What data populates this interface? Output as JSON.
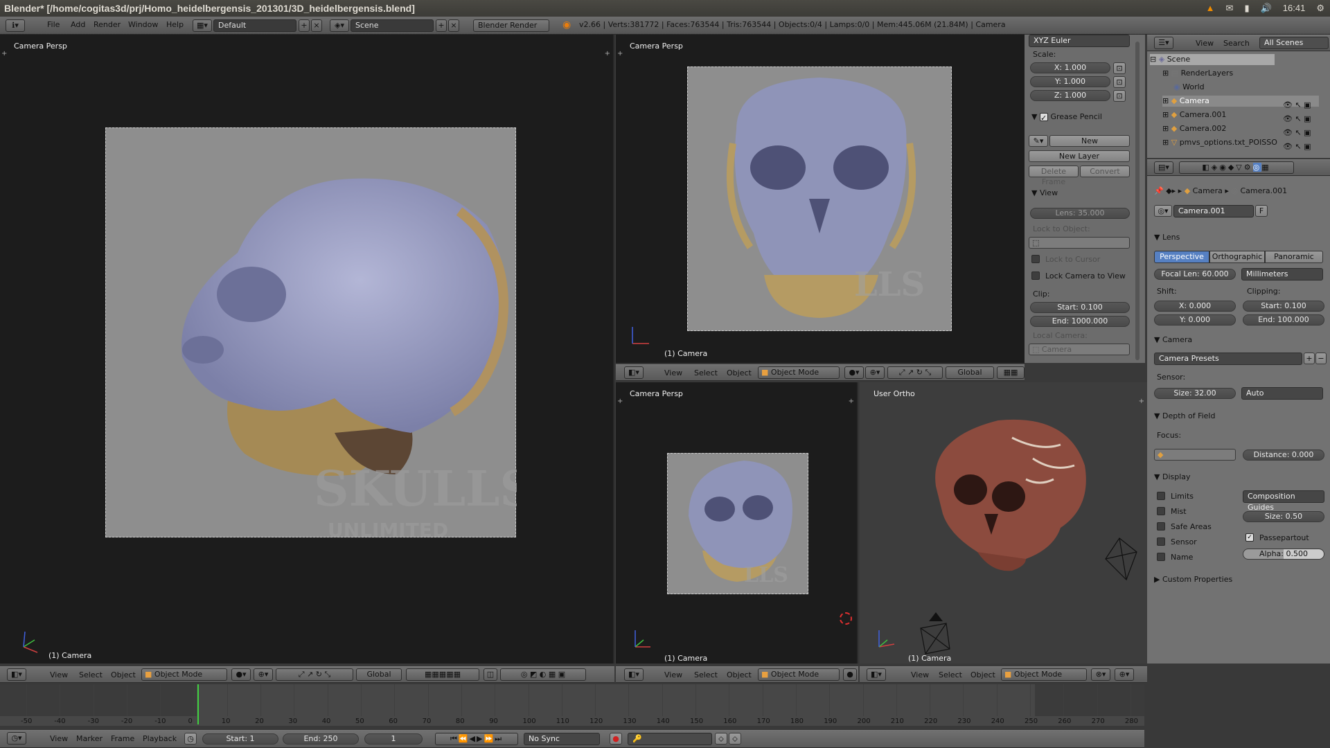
{
  "ubuntu": {
    "title": "Blender* [/home/cogitas3d/prj/Homo_heidelbergensis_201301/3D_heidelbergensis.blend]",
    "clock": "16:41"
  },
  "info": {
    "menus": [
      "File",
      "Add",
      "Render",
      "Window",
      "Help"
    ],
    "layout": "Default",
    "scene": "Scene",
    "engine": "Blender Render",
    "stats": "v2.66 | Verts:381772 | Faces:763544 | Tris:763544 | Objects:0/4 | Lamps:0/0 | Mem:445.06M (21.84M) | Camera"
  },
  "viewports": {
    "large": {
      "label": "Camera Persp",
      "camera": "(1) Camera"
    },
    "top_right": {
      "label": "Camera Persp",
      "camera": "(1) Camera"
    },
    "bottom_mid": {
      "label": "Camera Persp",
      "camera": "(1) Camera"
    },
    "bottom_right": {
      "label": "User Ortho",
      "camera": "(1) Camera"
    }
  },
  "view_header": {
    "menus": [
      "View",
      "Select",
      "Object"
    ],
    "mode": "Object Mode",
    "orientation": "Global"
  },
  "npanel": {
    "rotation_mode": "XYZ Euler",
    "scale_label": "Scale:",
    "scale": [
      "X: 1.000",
      "Y: 1.000",
      "Z: 1.000"
    ],
    "grease_pencil": "Grease Pencil",
    "new": "New",
    "new_layer": "New Layer",
    "delete_frame": "Delete Frame",
    "convert": "Convert",
    "view": "View",
    "lens": "Lens: 35.000",
    "lock_to_object": "Lock to Object:",
    "lock_to_cursor": "Lock to Cursor",
    "lock_camera_to_view": "Lock Camera to View",
    "clip": "Clip:",
    "clip_start": "Start: 0.100",
    "clip_end": "End: 1000.000",
    "local_camera": "Local Camera:",
    "camera": "Camera"
  },
  "outliner": {
    "menus": [
      "View",
      "Search"
    ],
    "filter": "All Scenes",
    "items": [
      "Scene",
      "RenderLayers",
      "World",
      "Camera",
      "Camera.001",
      "Camera.002",
      "pmvs_options.txt_POISSO"
    ]
  },
  "properties": {
    "breadcrumb": [
      "Camera",
      "Camera.001"
    ],
    "datablock": "Camera.001",
    "fake": "F",
    "lens_header": "Lens",
    "lens_tabs": [
      "Perspective",
      "Orthographic",
      "Panoramic"
    ],
    "focal_len": "Focal Len: 60.000",
    "units": "Millimeters",
    "shift": "Shift:",
    "clipping": "Clipping:",
    "shift_x": "X: 0.000",
    "shift_y": "Y: 0.000",
    "clip_start": "Start: 0.100",
    "clip_end": "End: 100.000",
    "camera_header": "Camera",
    "camera_presets": "Camera Presets",
    "sensor": "Sensor:",
    "sensor_size": "Size: 32.00",
    "sensor_fit": "Auto",
    "dof_header": "Depth of Field",
    "focus": "Focus:",
    "distance": "Distance: 0.000",
    "display_header": "Display",
    "display_items": [
      "Limits",
      "Mist",
      "Safe Areas",
      "Sensor",
      "Name"
    ],
    "composition_guides": "Composition Guides",
    "size": "Size: 0.50",
    "passepartout": "Passepartout",
    "alpha": "Alpha: 0.500",
    "custom_props": "Custom Properties"
  },
  "timeline": {
    "ticks": [
      "-50",
      "-40",
      "-30",
      "-20",
      "-10",
      "0",
      "10",
      "20",
      "30",
      "40",
      "50",
      "60",
      "70",
      "80",
      "90",
      "100",
      "110",
      "120",
      "130",
      "140",
      "150",
      "160",
      "170",
      "180",
      "190",
      "200",
      "210",
      "220",
      "230",
      "240",
      "250",
      "260",
      "270",
      "280"
    ],
    "menus": [
      "View",
      "Marker",
      "Frame",
      "Playback"
    ],
    "start": "Start: 1",
    "end": "End: 250",
    "current": "1",
    "sync": "No Sync"
  },
  "colors": {
    "viewport_bg": "#1c1c1c",
    "camera_frame": "#8e8e8e",
    "selected_tab": "#5680c2",
    "skull_blue": "#8f94b8",
    "skull_bone": "#b59b63",
    "skull_red": "#8c4b3e"
  }
}
